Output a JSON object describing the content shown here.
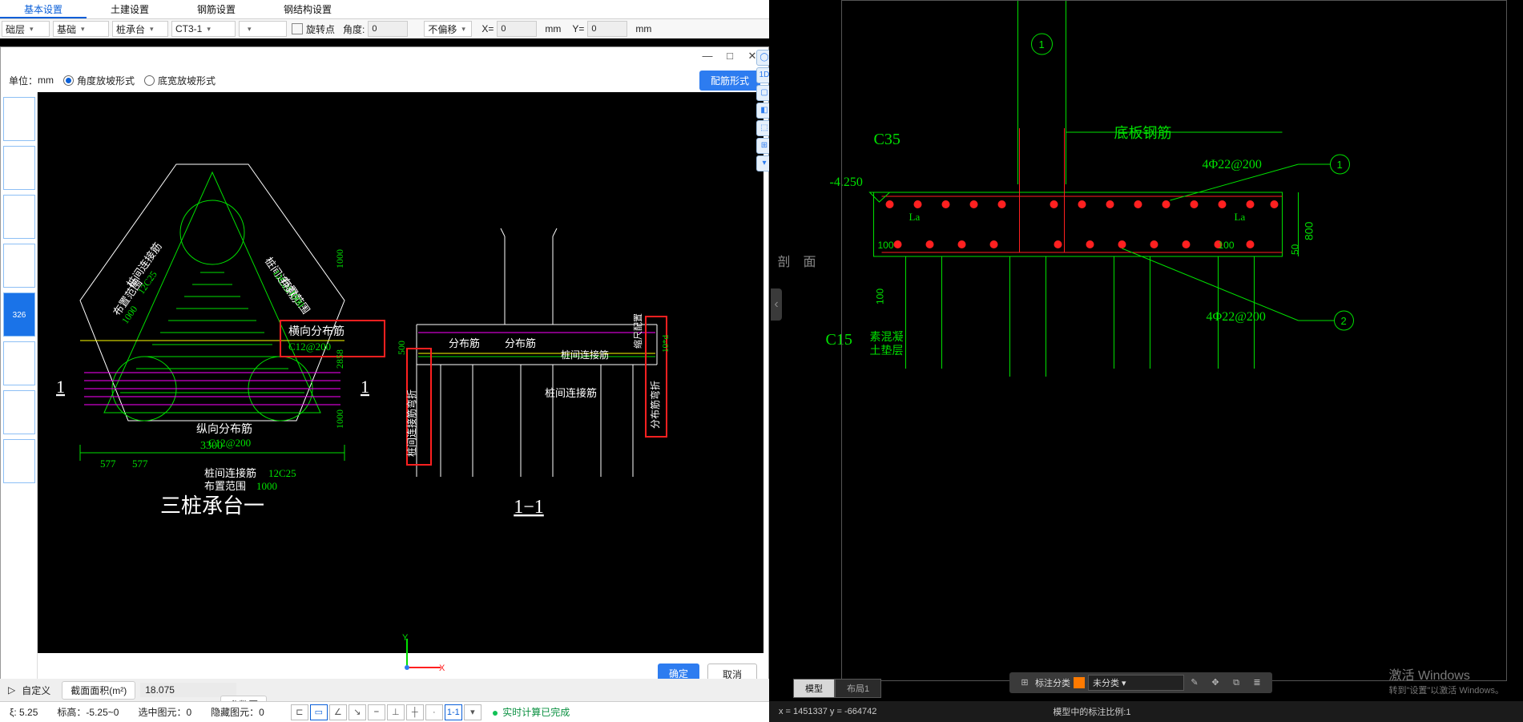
{
  "topTabs": [
    "基本设置",
    "土建设置",
    "钢筋设置",
    "钢结构设置"
  ],
  "toolbar": {
    "dd1": "础层",
    "dd2": "基础",
    "dd3": "桩承台",
    "dd4": "CT3-1",
    "rotLabel": "旋转点",
    "angLabel": "角度:",
    "angVal": "0",
    "offLabel": "不偏移",
    "xLabel": "X=",
    "xVal": "0",
    "yLabel": "Y=",
    "yVal": "0",
    "unit": "mm"
  },
  "dialog": {
    "unitLabel": "单位：",
    "unit": "mm",
    "rad1": "角度放坡形式",
    "rad2": "底宽放坡形式",
    "cfgBtn": "配筋形式",
    "ok": "确定",
    "cancel": "取消",
    "thumbSel": "326"
  },
  "leftStat": {
    "areaLabel": "截面面积(m²)",
    "areaVal": "18.075",
    "paramBtn": "参数图",
    "custom": "自定义"
  },
  "bottomBar": {
    "v1": "ξ: 5.25",
    "v2": "标高：-5.25~0",
    "v3": "选中图元：0",
    "v4": "隐藏图元：0",
    "calc": "实时计算已完成"
  },
  "cad": {
    "coords": "x = 1451337  y = -664742",
    "scale": "模型中的标注比例:1",
    "tabs": [
      "模型",
      "布局1"
    ],
    "tagLabel": "标注分类",
    "tagVal": "未分类",
    "winact1": "激活 Windows",
    "winact2": "转到\"设置\"以激活 Windows。"
  },
  "draw": {
    "title": "三桩承台一",
    "sec": "1-1",
    "secHead": "1−1",
    "hDist": "横向分布筋",
    "hDistSpec": "C12@200",
    "vDist": "纵向分布筋",
    "vDistSpec": "C12@200",
    "conn": "桩间连接筋",
    "connSpec": "12C25",
    "range": "布置范围",
    "rangeVal": "1000",
    "dim3300": "3300",
    "d577": "577",
    "d1000": "1000",
    "d2858": "2858",
    "d500": "500",
    "d10d": "10*d",
    "fb": "分布筋",
    "zl": "桩间连接筋",
    "zv": "桩间连接筋弯折",
    "fv": "分布筋弯折",
    "rz": "缩尺配置"
  },
  "rdraw": {
    "pm": "剖 面",
    "c35": "C35",
    "c15": "C15",
    "s100": "100",
    "s800": "800",
    "s50": "50",
    "elev": "-4.250",
    "la": "La",
    "db": "底板钢筋",
    "r1": "4Φ22@200",
    "r2": "4Φ22@200",
    "stxt": "素混凝",
    "stxt2": "土垫层",
    "n1": "1",
    "n2": "2"
  }
}
